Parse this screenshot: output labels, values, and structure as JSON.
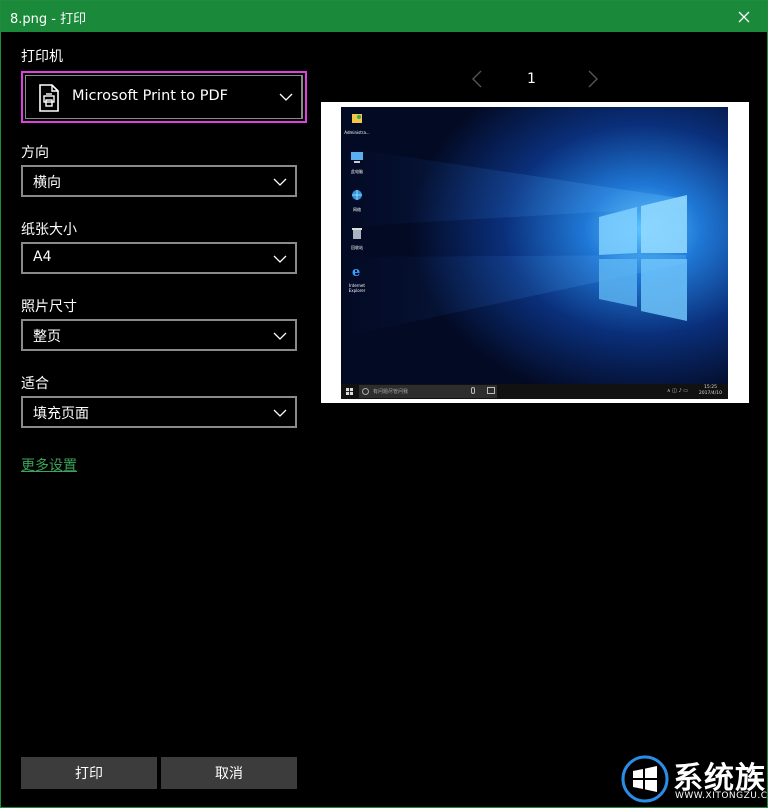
{
  "window": {
    "title": "8.png - 打印"
  },
  "printer": {
    "label": "打印机",
    "value": "Microsoft Print to PDF"
  },
  "orientation": {
    "label": "方向",
    "value": "横向"
  },
  "paper_size": {
    "label": "纸张大小",
    "value": "A4"
  },
  "photo_size": {
    "label": "照片尺寸",
    "value": "整页"
  },
  "fit": {
    "label": "适合",
    "value": "填充页面"
  },
  "more_settings": "更多设置",
  "pager": {
    "page": "1"
  },
  "buttons": {
    "print": "打印",
    "cancel": "取消"
  },
  "preview": {
    "desktop_icons": [
      {
        "label": "Administra...",
        "icon": "user-folder-icon"
      },
      {
        "label": "此电脑",
        "icon": "computer-icon"
      },
      {
        "label": "网络",
        "icon": "network-icon"
      },
      {
        "label": "回收站",
        "icon": "recycle-bin-icon"
      },
      {
        "label": "Internet Explorer",
        "icon": "internet-explorer-icon"
      }
    ],
    "taskbar": {
      "search_placeholder": "有问题尽管问我",
      "time": "15:25",
      "date": "2017/4/10"
    }
  },
  "watermark": {
    "text": "系统族",
    "subtext": "WWW.XITONGZU.COM"
  },
  "colors": {
    "titlebar": "#1a8a3a",
    "accent_link": "#3aa45a",
    "highlight_border": "#e040e0"
  }
}
